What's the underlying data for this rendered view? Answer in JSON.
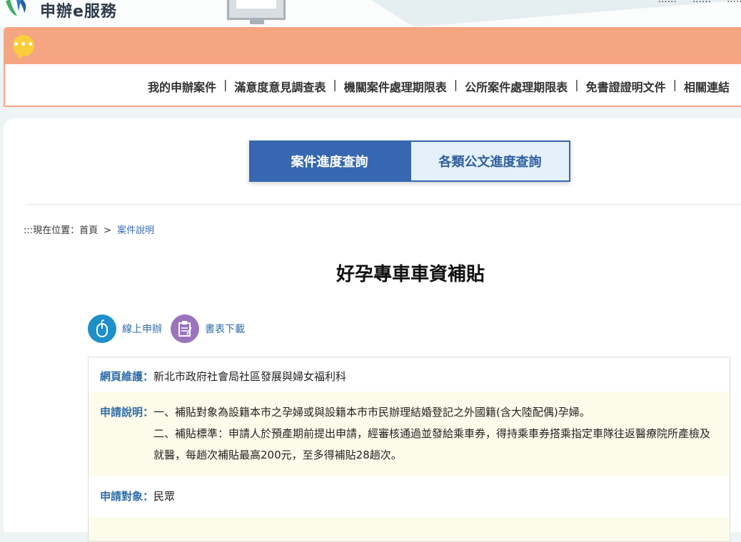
{
  "header": {
    "site_title": "申辦e服務",
    "top_links": [
      "……",
      "……",
      "……"
    ]
  },
  "nav": {
    "items": [
      "我的申辦案件",
      "滿意度意見調查表",
      "機關案件處理期限表",
      "公所案件處理期限表",
      "免書證證明文件",
      "相關連結"
    ],
    "separator": "|"
  },
  "tabs": {
    "active": "案件進度查詢",
    "inactive": "各類公文進度查詢"
  },
  "breadcrumb": {
    "prefix": ":::現在位置：",
    "home": "首頁",
    "separator": ">",
    "current": "案件說明"
  },
  "page_title": "好孕專車車資補貼",
  "actions": {
    "online_apply": "線上申辦",
    "form_download": "書表下載"
  },
  "info": {
    "maintainer_label": "網頁維護：",
    "maintainer_value": "新北市政府社會局社區發展與婦女福利科",
    "desc_label": "申請說明：",
    "desc_line1": "一、補貼對象為設籍本市之孕婦或與設籍本市市民辦理結婚登記之外國籍(含大陸配偶)孕婦。",
    "desc_line2": "二、補貼標準：申請人於預產期前提出申請，經審核通過並發給乘車券，得持乘車券搭乘指定車隊往返醫療院所產檢及就醫，每趟次補貼最高200元，至多得補貼28趟次。",
    "target_label": "申請對象：",
    "target_value": "民眾"
  },
  "colors": {
    "banner": "#f5a582",
    "tab_active": "#3667b0",
    "link_blue": "#2f6da8",
    "alt_row": "#fdfbea"
  }
}
